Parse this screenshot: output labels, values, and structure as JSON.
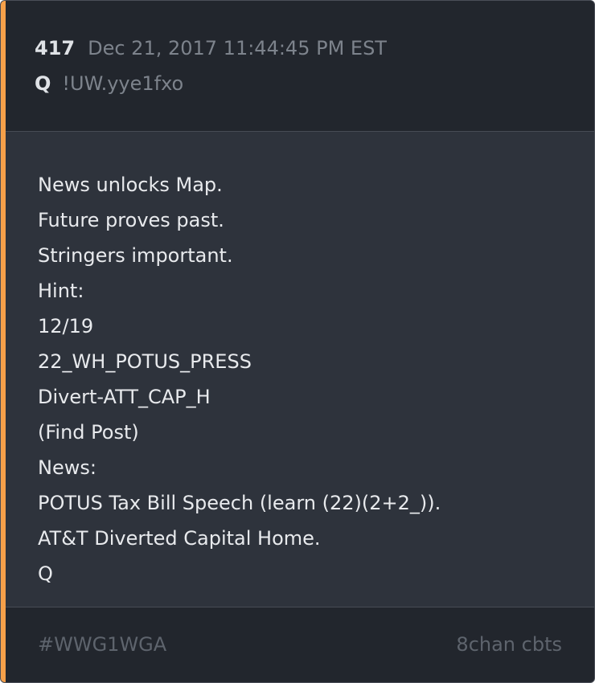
{
  "colors": {
    "accent": "#f6a049",
    "card_background": "#2e333c",
    "header_background": "#22262d",
    "primary_text": "#e8eaed",
    "muted_text": "#7d838c",
    "footer_text": "#5e646d"
  },
  "post": {
    "number": "417",
    "date": "Dec 21, 2017 11:44:45 PM EST",
    "author": "Q",
    "tripcode": "!UW.yye1fxo",
    "lines": [
      "News unlocks Map.",
      "Future proves past.",
      "Stringers important.",
      "Hint:",
      "12/19",
      "22_WH_POTUS_PRESS",
      "Divert-ATT_CAP_H",
      "(Find Post)",
      "News:",
      "POTUS Tax Bill Speech (learn (22)(2+2_)).",
      "AT&T Diverted Capital Home.",
      "Q"
    ]
  },
  "footer": {
    "hashtag": "#WWG1WGA",
    "source": "8chan cbts"
  }
}
